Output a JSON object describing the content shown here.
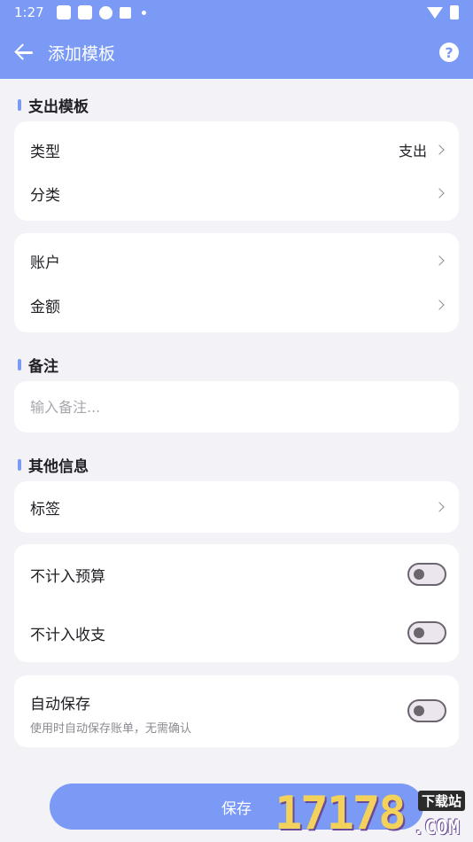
{
  "status_bar": {
    "time": "1:27"
  },
  "app_bar": {
    "title": "添加模板"
  },
  "sections": {
    "expense_template": "支出模板",
    "remark": "备注",
    "other_info": "其他信息"
  },
  "card1": {
    "type_label": "类型",
    "type_value": "支出",
    "category_label": "分类"
  },
  "card2": {
    "account_label": "账户",
    "amount_label": "金额"
  },
  "remark": {
    "placeholder": "输入备注...",
    "value": ""
  },
  "tags": {
    "label": "标签"
  },
  "toggles": {
    "exclude_budget": {
      "label": "不计入预算",
      "on": false
    },
    "exclude_income_expense": {
      "label": "不计入收支",
      "on": false
    },
    "auto_save": {
      "label": "自动保存",
      "sub": "使用时自动保存账单，无需确认",
      "on": false
    }
  },
  "save_button": {
    "label": "保存"
  },
  "watermark": {
    "digits": "17178",
    "com": ".COM",
    "tag": "下载站"
  },
  "colors": {
    "accent": "#7a9af5",
    "background": "#f2f2f7"
  }
}
